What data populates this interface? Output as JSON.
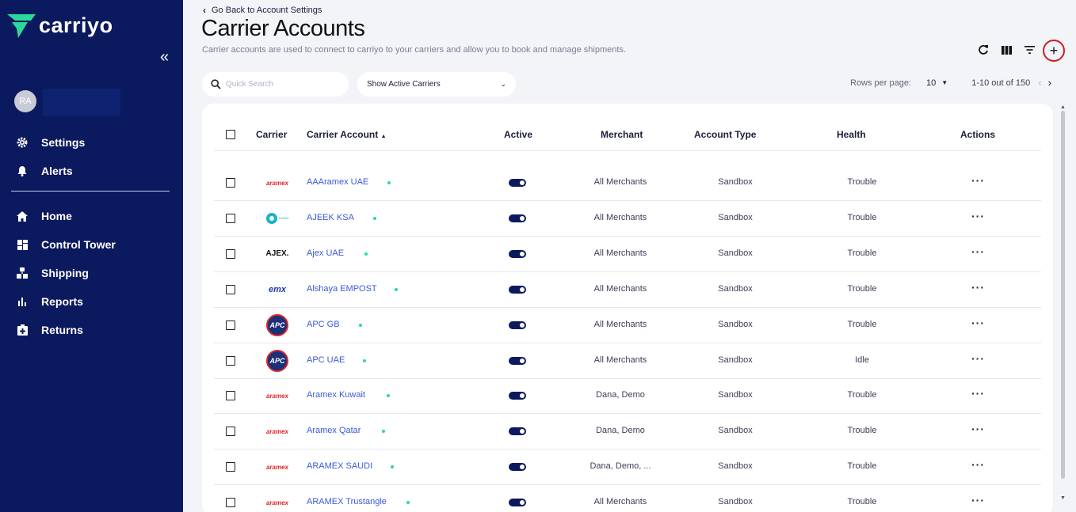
{
  "sidebar": {
    "brand": "carriyo",
    "avatar_initials": "RA",
    "top_items": [
      {
        "label": "Settings",
        "icon": "gear-icon"
      },
      {
        "label": "Alerts",
        "icon": "bell-icon"
      }
    ],
    "nav_items": [
      {
        "label": "Home",
        "icon": "home-icon"
      },
      {
        "label": "Control Tower",
        "icon": "dashboard-icon"
      },
      {
        "label": "Shipping",
        "icon": "shipping-icon"
      },
      {
        "label": "Reports",
        "icon": "bar-chart-icon"
      },
      {
        "label": "Returns",
        "icon": "returns-icon"
      }
    ]
  },
  "header": {
    "back_label": "Go Back to Account Settings",
    "title": "Carrier Accounts",
    "subtitle": "Carrier accounts are used to connect to carriyo to your carriers and allow you to book and manage shipments."
  },
  "toolbar": {
    "icons": [
      "refresh-icon",
      "columns-icon",
      "filter-icon",
      "add-icon"
    ]
  },
  "filters": {
    "search_placeholder": "Quick Search",
    "status_select": "Show Active Carriers"
  },
  "pagination": {
    "rows_per_page_label": "Rows per page:",
    "rows_per_page": "10",
    "range": "1-10 out of 150"
  },
  "table": {
    "columns": {
      "carrier": "Carrier",
      "carrier_account": "Carrier Account",
      "active": "Active",
      "merchant": "Merchant",
      "account_type": "Account Type",
      "health": "Health",
      "actions": "Actions"
    },
    "rows": [
      {
        "logo": "aramex",
        "logo_text": "aramex",
        "account": "AAAramex UAE",
        "active": true,
        "merchant": "All Merchants",
        "type": "Sandbox",
        "health": "Trouble"
      },
      {
        "logo": "ajeek",
        "logo_text": "AJEEK",
        "account": "AJEEK KSA",
        "active": true,
        "merchant": "All Merchants",
        "type": "Sandbox",
        "health": "Trouble"
      },
      {
        "logo": "ajex",
        "logo_text": "AJEX.",
        "account": "Ajex UAE",
        "active": true,
        "merchant": "All Merchants",
        "type": "Sandbox",
        "health": "Trouble"
      },
      {
        "logo": "emx",
        "logo_text": "emx",
        "account": "Alshaya EMPOST",
        "active": true,
        "merchant": "All Merchants",
        "type": "Sandbox",
        "health": "Trouble"
      },
      {
        "logo": "apc",
        "logo_text": "APC",
        "account": "APC GB",
        "active": true,
        "merchant": "All Merchants",
        "type": "Sandbox",
        "health": "Trouble"
      },
      {
        "logo": "apc",
        "logo_text": "APC",
        "account": "APC UAE",
        "active": true,
        "merchant": "All Merchants",
        "type": "Sandbox",
        "health": "Idle"
      },
      {
        "logo": "aramex",
        "logo_text": "aramex",
        "account": "Aramex Kuwait",
        "active": true,
        "merchant": "Dana, Demo",
        "type": "Sandbox",
        "health": "Trouble"
      },
      {
        "logo": "aramex",
        "logo_text": "aramex",
        "account": "Aramex Qatar",
        "active": true,
        "merchant": "Dana, Demo",
        "type": "Sandbox",
        "health": "Trouble"
      },
      {
        "logo": "aramex",
        "logo_text": "aramex",
        "account": "ARAMEX SAUDI",
        "active": true,
        "merchant": "Dana, Demo, ...",
        "type": "Sandbox",
        "health": "Trouble"
      },
      {
        "logo": "aramex",
        "logo_text": "aramex",
        "account": "ARAMEX Trustangle",
        "active": true,
        "merchant": "All Merchants",
        "type": "Sandbox",
        "health": "Trouble"
      }
    ]
  },
  "colors": {
    "sidebar_bg": "#0b1a5e",
    "link": "#3a5ad8",
    "status_dot": "#2bd99a",
    "highlight_ring": "#d01c1c"
  }
}
